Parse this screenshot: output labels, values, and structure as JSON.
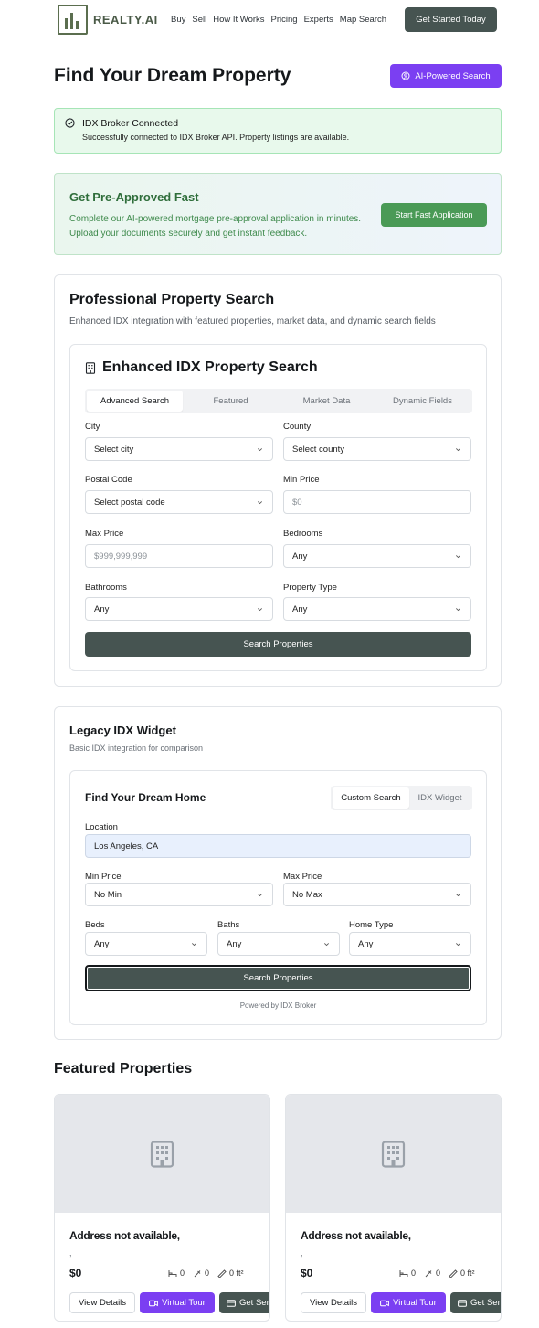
{
  "brand": {
    "name": "REALTY.AI"
  },
  "nav": {
    "links": [
      "Buy",
      "Sell",
      "How It Works",
      "Pricing",
      "Experts",
      "Map Search"
    ],
    "cta": "Get Started Today"
  },
  "header": {
    "title": "Find Your Dream Property",
    "ai_button": "AI-Powered Search"
  },
  "alert": {
    "title": "IDX Broker Connected",
    "message": "Successfully connected to IDX Broker API. Property listings are available."
  },
  "preapproval": {
    "title": "Get Pre-Approved Fast",
    "description": "Complete our AI-powered mortgage pre-approval application in minutes. Upload your documents securely and get instant feedback.",
    "button": "Start Fast Application"
  },
  "pro_search": {
    "title": "Professional Property Search",
    "subtitle": "Enhanced IDX integration with featured properties, market data, and dynamic search fields",
    "panel_title": "Enhanced IDX Property Search",
    "tabs": [
      "Advanced Search",
      "Featured",
      "Market Data",
      "Dynamic Fields"
    ],
    "fields": {
      "city": {
        "label": "City",
        "value": "Select city"
      },
      "county": {
        "label": "County",
        "value": "Select county"
      },
      "postal": {
        "label": "Postal Code",
        "value": "Select postal code"
      },
      "min_price": {
        "label": "Min Price",
        "placeholder": "$0"
      },
      "max_price": {
        "label": "Max Price",
        "placeholder": "$999,999,999"
      },
      "bedrooms": {
        "label": "Bedrooms",
        "value": "Any"
      },
      "bathrooms": {
        "label": "Bathrooms",
        "value": "Any"
      },
      "property_type": {
        "label": "Property Type",
        "value": "Any"
      }
    },
    "search_button": "Search Properties"
  },
  "legacy": {
    "title": "Legacy IDX Widget",
    "subtitle": "Basic IDX integration for comparison",
    "panel_title": "Find Your Dream Home",
    "tabs": [
      "Custom Search",
      "IDX Widget"
    ],
    "location": {
      "label": "Location",
      "value": "Los Angeles, CA"
    },
    "min_price": {
      "label": "Min Price",
      "value": "No Min"
    },
    "max_price": {
      "label": "Max Price",
      "value": "No Max"
    },
    "beds": {
      "label": "Beds",
      "value": "Any"
    },
    "baths": {
      "label": "Baths",
      "value": "Any"
    },
    "home_type": {
      "label": "Home Type",
      "value": "Any"
    },
    "search_button": "Search Properties",
    "powered_by": "Powered by IDX Broker"
  },
  "featured": {
    "title": "Featured Properties",
    "properties": [
      {
        "address": "Address not available,",
        "city": ",",
        "price": "$0",
        "beds": "0",
        "baths": "0",
        "sqft": "0 ft²",
        "details": "View Details",
        "tour": "Virtual Tour",
        "more": "Get Senior"
      },
      {
        "address": "Address not available,",
        "city": ",",
        "price": "$0",
        "beds": "0",
        "baths": "0",
        "sqft": "0 ft²",
        "details": "View Details",
        "tour": "Virtual Tour",
        "more": "Get Senior"
      }
    ]
  },
  "colors": {
    "primary_dark": "#465451",
    "accent_violet": "#7b3ff2",
    "success_green": "#4a9a56"
  }
}
